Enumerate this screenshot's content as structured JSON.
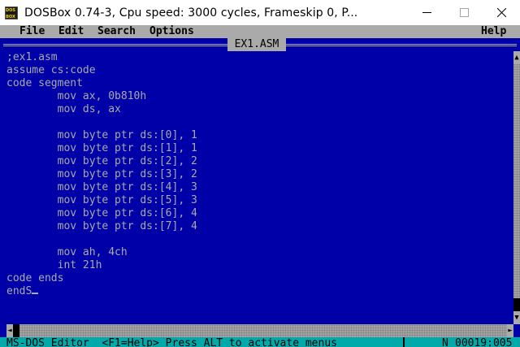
{
  "window": {
    "title": "DOSBox 0.74-3, Cpu speed:     3000 cycles, Frameskip  0, P...",
    "icon_letters": [
      "DOS",
      "BOX"
    ]
  },
  "menu": {
    "items": [
      "File",
      "Edit",
      "Search",
      "Options"
    ],
    "help": "Help"
  },
  "editor": {
    "filename": "EX1.ASM",
    "lines": [
      ";ex1.asm",
      "assume cs:code",
      "code segment",
      "        mov ax, 0b810h",
      "        mov ds, ax",
      "",
      "        mov byte ptr ds:[0], 1",
      "        mov byte ptr ds:[1], 1",
      "        mov byte ptr ds:[2], 2",
      "        mov byte ptr ds:[3], 2",
      "        mov byte ptr ds:[4], 3",
      "        mov byte ptr ds:[5], 3",
      "        mov byte ptr ds:[6], 4",
      "        mov byte ptr ds:[7], 4",
      "",
      "        mov ah, 4ch",
      "        int 21h",
      "code ends",
      "endS"
    ]
  },
  "status": {
    "text": "MS-DOS Editor  <F1=Help> Press ALT to activate menus",
    "mode": "N",
    "position": "00019:005"
  },
  "icons": {
    "minimize": "minimize-icon",
    "maximize": "maximize-icon",
    "close": "close-icon",
    "scroll_up": "arrow-up-icon",
    "scroll_down": "arrow-down-icon",
    "scroll_left": "arrow-left-icon",
    "scroll_right": "arrow-right-icon"
  },
  "colors": {
    "dos_blue": "#0000a8",
    "dos_gray": "#aaaaaa",
    "dos_cyan": "#00aaaa"
  }
}
